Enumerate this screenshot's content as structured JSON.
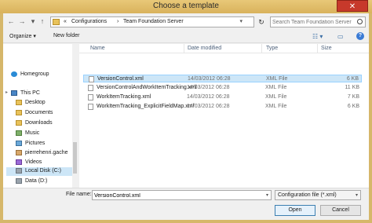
{
  "window": {
    "title": "Choose a template",
    "close_glyph": "✕"
  },
  "address": {
    "back_glyph": "←",
    "forward_glyph": "→",
    "up_glyph": "↑",
    "crumbs": [
      "«",
      "Configurations",
      "›",
      "Team Foundation Server"
    ],
    "dropdown_glyph": "▾",
    "refresh_glyph": "↻"
  },
  "search": {
    "placeholder": "Search Team Foundation Server"
  },
  "toolbar": {
    "organize_label": "Organize ▾",
    "new_folder_label": "New folder",
    "view_glyph": "☷ ▾",
    "pane_glyph": "▭",
    "help_glyph": "?"
  },
  "nav": {
    "items": [
      {
        "label": "Homegroup"
      },
      {
        "label": "This PC"
      },
      {
        "label": "Desktop"
      },
      {
        "label": "Documents"
      },
      {
        "label": "Downloads"
      },
      {
        "label": "Music"
      },
      {
        "label": "Pictures"
      },
      {
        "label": "pierrehenri.gache"
      },
      {
        "label": "Videos"
      },
      {
        "label": "Local Disk (C:)"
      },
      {
        "label": "Data (D:)"
      }
    ]
  },
  "files": {
    "columns": [
      "Name",
      "Date modified",
      "Type",
      "Size"
    ],
    "rows": [
      {
        "name": "VersionControl.xml",
        "date": "14/03/2012 06:28",
        "type": "XML File",
        "size": "6 KB"
      },
      {
        "name": "VersionControlAndWorkItemTracking.xml",
        "date": "14/03/2012 06:28",
        "type": "XML File",
        "size": "11 KB"
      },
      {
        "name": "WorkItemTracking.xml",
        "date": "14/03/2012 06:28",
        "type": "XML File",
        "size": "7 KB"
      },
      {
        "name": "WorkItemTracking_ExplicitFieldMap.xml",
        "date": "14/03/2012 06:28",
        "type": "XML File",
        "size": "6 KB"
      }
    ]
  },
  "bottom": {
    "filename_label": "File name:",
    "filename_value": "VersionControl.xml",
    "filetype_value": "Configuration file (*.xml)",
    "open_label": "Open",
    "cancel_label": "Cancel"
  }
}
